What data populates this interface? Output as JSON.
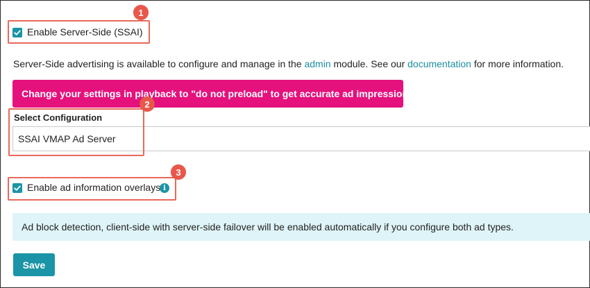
{
  "ssai": {
    "checkbox_label": "Enable Server-Side (SSAI)",
    "checked": true
  },
  "description": {
    "prefix": "Server-Side advertising is available to configure and manage in the ",
    "admin_link": "admin",
    "middle": " module. See our ",
    "documentation_link": "documentation",
    "suffix": " for more information."
  },
  "warning_banner": {
    "text": "Change your settings in playback to \"do not preload\" to get accurate ad impressions."
  },
  "configuration": {
    "label": "Select Configuration",
    "value": "SSAI VMAP Ad Server"
  },
  "overlays": {
    "checkbox_label": "Enable ad information overlays",
    "checked": true,
    "info_icon": "i"
  },
  "notice": {
    "text": "Ad block detection, client-side with server-side failover will be enabled automatically if you configure both ad types."
  },
  "actions": {
    "save_label": "Save"
  },
  "annotations": {
    "marker_1": "1",
    "marker_2": "2",
    "marker_3": "3"
  },
  "colors": {
    "accent": "#1a94a6",
    "warning_bg": "#e5117d",
    "notice_bg": "#dff4f8",
    "highlight": "#e8685b"
  }
}
